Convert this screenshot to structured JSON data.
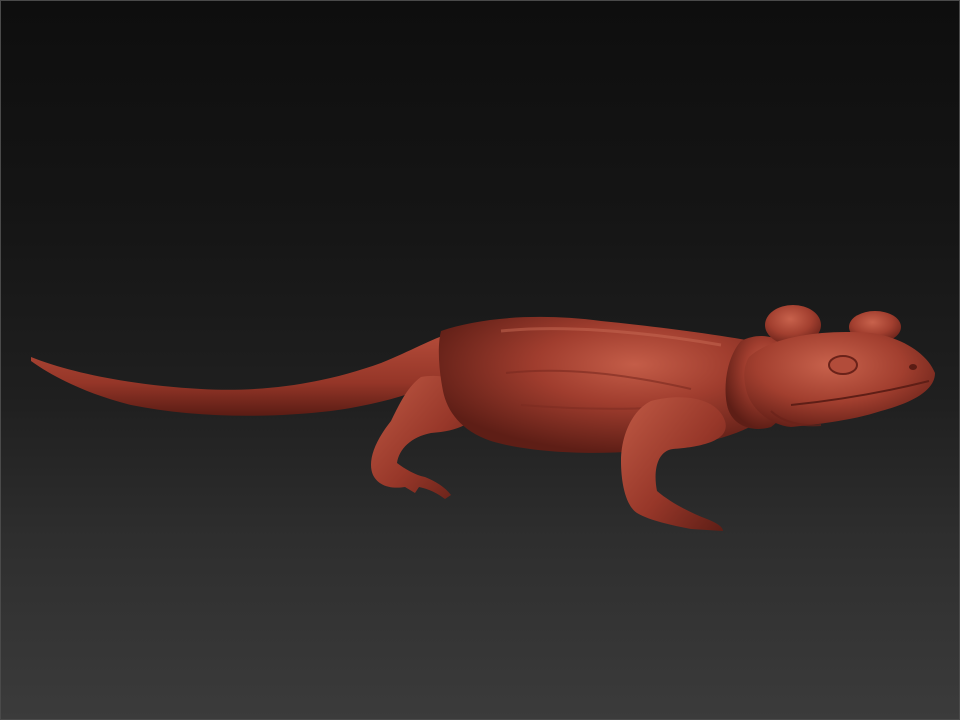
{
  "viewport": {
    "background_top": "#0e0e0e",
    "background_bottom": "#3b3b3b",
    "border_color": "#4a4a4a"
  },
  "model": {
    "icon": "lizard-sculpt-icon",
    "material_color": "#9e3a2c",
    "highlight_color": "#c9644f",
    "shadow_color": "#5a1d15"
  }
}
